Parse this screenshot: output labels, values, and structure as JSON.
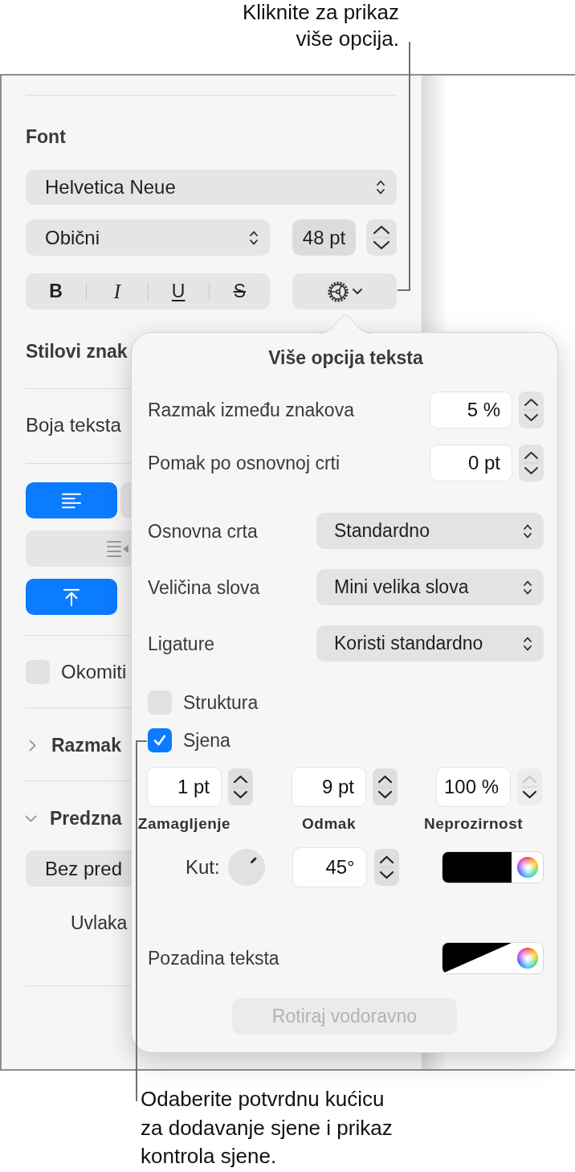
{
  "callouts": [
    {
      "text": "Kliknite za prikaz\nviše opcija."
    },
    {
      "text": "Odaberite potvrdnu kućicu\nza dodavanje sjene i prikaz\nkontrola sjene."
    }
  ],
  "sidebar": {
    "font": {
      "heading": "Font",
      "family": "Helvetica Neue",
      "typeface": "Obični",
      "size": "48 pt",
      "style_buttons": [
        {
          "label": "B",
          "kind": "bold",
          "selected": false
        },
        {
          "label": "I",
          "kind": "italic",
          "selected": false
        },
        {
          "label": "U",
          "kind": "underline",
          "selected": false
        },
        {
          "label": "S",
          "kind": "strikethrough",
          "selected": false
        }
      ]
    },
    "character_styles": {
      "label": "Stilovi znak"
    },
    "text_color": {
      "label": "Boja teksta"
    },
    "alignment": {
      "horizontal": [
        {
          "selected": true
        },
        {
          "selected": false
        }
      ],
      "vertical": [
        {
          "selected": true
        }
      ]
    },
    "vertical_text": {
      "label": "Okomiti",
      "checked": false
    },
    "sections": [
      {
        "heading": "Razmak",
        "expanded": false
      },
      {
        "heading": "Predzna",
        "expanded": true,
        "popup": "Bez pred",
        "indent_label": "Uvlaka"
      }
    ]
  },
  "popover": {
    "title": "Više opcija teksta",
    "steppers": [
      {
        "label": "Razmak između znakova",
        "value": "5 %"
      },
      {
        "label": "Pomak po osnovnoj crti",
        "value": "0 pt"
      }
    ],
    "popups": [
      {
        "label": "Osnovna crta",
        "value": "Standardno"
      },
      {
        "label": "Veličina slova",
        "value": "Mini velika slova"
      },
      {
        "label": "Ligature",
        "value": "Koristi standardno"
      }
    ],
    "checkboxes": [
      {
        "label": "Struktura",
        "checked": false
      },
      {
        "label": "Sjena",
        "checked": true
      }
    ],
    "shadow": {
      "fields": [
        {
          "value": "1 pt",
          "label": "Zamagljenje",
          "up_disabled": false
        },
        {
          "value": "9 pt",
          "label": "Odmak",
          "up_disabled": false
        },
        {
          "value": "100 %",
          "label": "Neprozirnost",
          "up_disabled": true
        }
      ],
      "angle_label": "Kut:",
      "angle": "45°"
    },
    "text_background": {
      "label": "Pozadina teksta"
    },
    "rotate_button": {
      "label": "Rotiraj vodoravno",
      "disabled": true
    }
  }
}
